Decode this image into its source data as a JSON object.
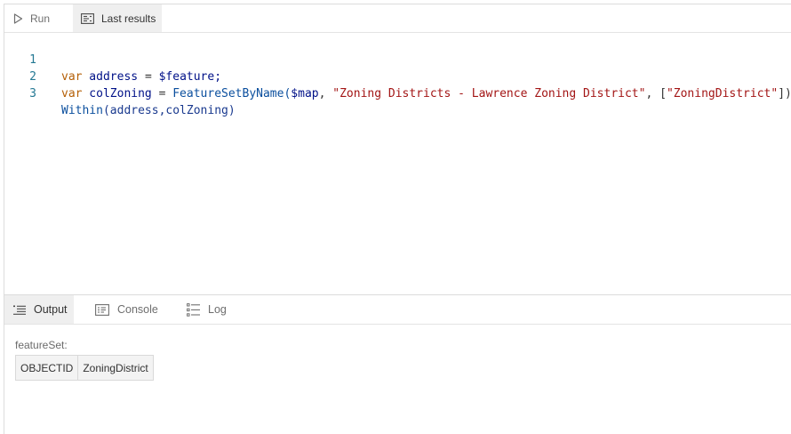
{
  "toolbar": {
    "run_label": "Run",
    "results_label": "Last results"
  },
  "editor": {
    "lines": [
      {
        "number": "1",
        "tokens": [
          "var",
          " address ",
          "=",
          " $feature;"
        ]
      },
      {
        "number": "2",
        "tokens": [
          "var",
          " colZoning ",
          "=",
          " FeatureSetByName(",
          "$map",
          ", ",
          "\"Zoning Districts - Lawrence Zoning District\"",
          ", [",
          "\"ZoningDistrict\"",
          "])"
        ]
      },
      {
        "number": "3",
        "tokens": [
          "Within",
          "(address,colZoning)"
        ]
      }
    ]
  },
  "output_tabs": {
    "output": "Output",
    "console": "Console",
    "log": "Log"
  },
  "output": {
    "label": "featureSet:",
    "columns": [
      "OBJECTID",
      "ZoningDistrict"
    ]
  },
  "icons": {
    "run": "play-icon",
    "results": "results-icon",
    "output": "list-icon",
    "console": "console-icon",
    "log": "log-icon"
  }
}
